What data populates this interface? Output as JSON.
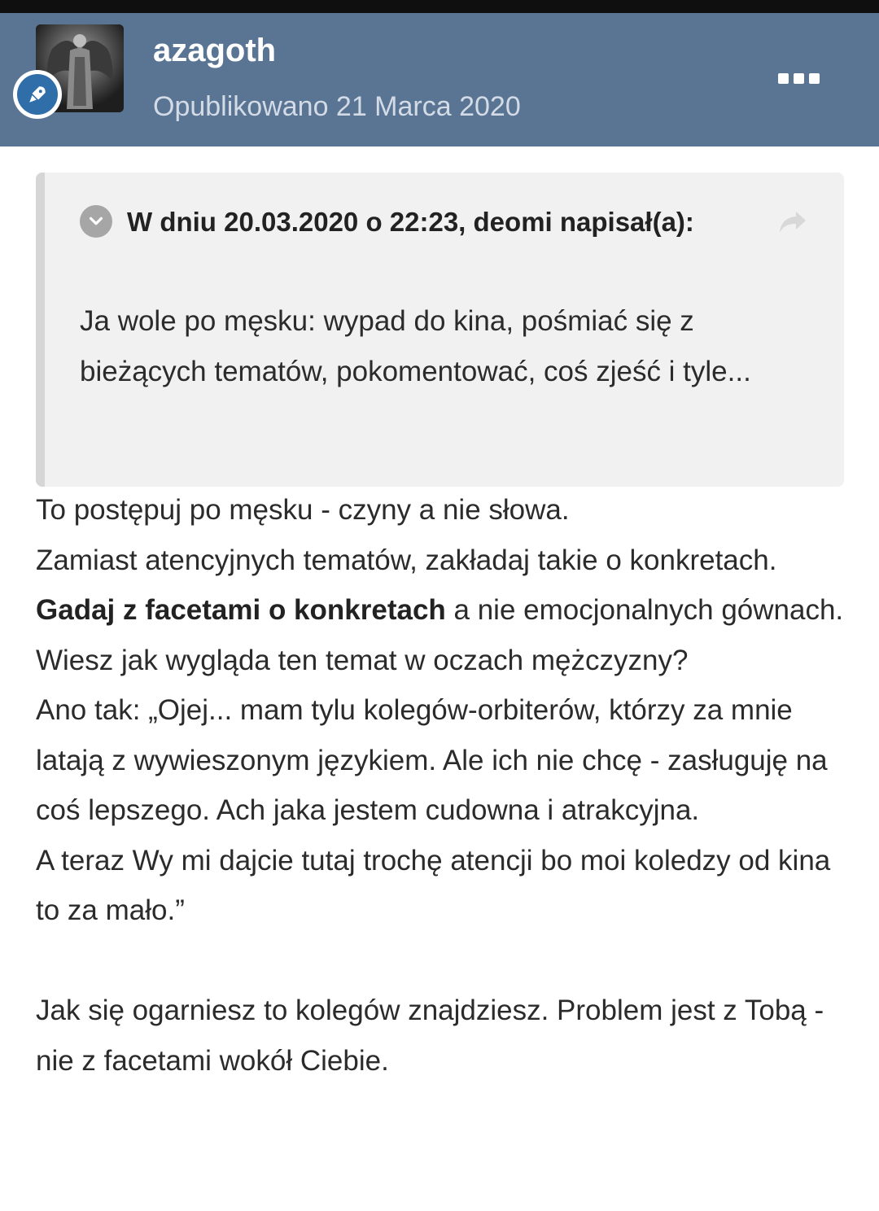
{
  "header": {
    "username": "azagoth",
    "posted": "Opublikowano 21 Marca 2020"
  },
  "quote": {
    "citation": "W dniu 20.03.2020 o 22:23, deomi napisał(a):",
    "text": "Ja wole po męsku: wypad do kina, pośmiać się z bieżących tematów, pokomentować, coś zjeść i tyle..."
  },
  "post": {
    "line1": "To postępuj po męsku - czyny a nie słowa.",
    "para2_before": "Zamiast atencyjnych tematów, zakładaj takie o konkretach. ",
    "para2_bold": "Gadaj z facetami o konkretach",
    "para2_after": " a nie emocjonalnych gównach.",
    "line3": "Wiesz jak wygląda ten temat w oczach mężczyzny?",
    "para4": "Ano tak: „Ojej... mam tylu kolegów-orbiterów, którzy za mnie latają z wywieszonym językiem. Ale ich nie chcę - zasługuję na coś lepszego. Ach jaka jestem cudowna i atrakcyjna.",
    "para5": "A teraz Wy mi dajcie tutaj trochę atencji bo moi koledzy od kina to za mało.”",
    "para6": "Jak się ogarniesz to kolegów znajdziesz. Problem jest z Tobą - nie z facetami wokół Ciebie."
  },
  "colors": {
    "header_bg": "#5a7493",
    "badge_bg": "#2f6ea9",
    "quote_bg": "#f1f1f1"
  },
  "icons": {
    "avatar": "angel-statue-avatar",
    "badge": "rocket-icon",
    "menu": "more-dots-icon",
    "toggle": "chevron-down-icon",
    "share": "share-arrow-icon"
  }
}
